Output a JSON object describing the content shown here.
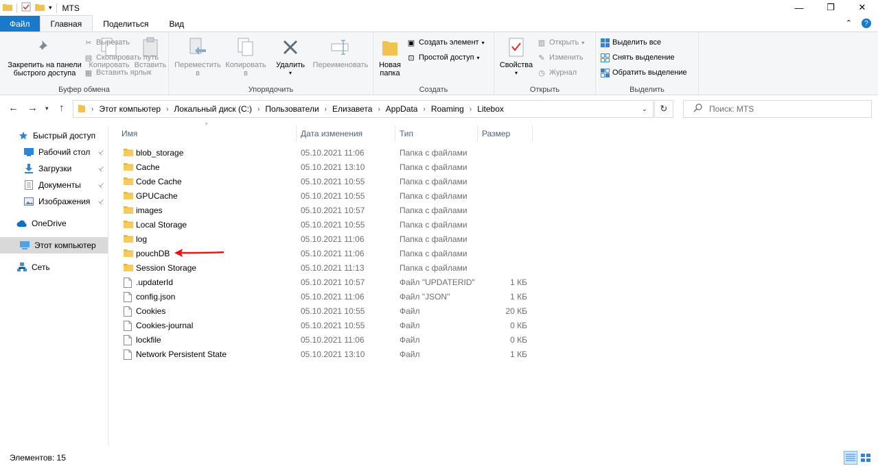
{
  "window": {
    "title": "MTS",
    "minimize": "—",
    "maximize": "❐",
    "close": "✕"
  },
  "tabs": {
    "file": "Файл",
    "home": "Главная",
    "share": "Поделиться",
    "view": "Вид"
  },
  "ribbon": {
    "clipboard": {
      "label": "Буфер обмена",
      "pin": "Закрепить на панели быстрого доступа",
      "pin_line1": "Закрепить на панели",
      "pin_line2": "быстрого доступа",
      "copy": "Копировать",
      "paste": "Вставить",
      "cut": "Вырезать",
      "copy_path": "Скопировать путь",
      "paste_shortcut": "Вставить ярлык"
    },
    "organize": {
      "label": "Упорядочить",
      "move_line1": "Переместить",
      "move_line2": "в",
      "copy_line1": "Копировать",
      "copy_line2": "в",
      "delete": "Удалить",
      "rename": "Переименовать"
    },
    "new": {
      "label": "Создать",
      "new_folder_line1": "Новая",
      "new_folder_line2": "папка",
      "new_item": "Создать элемент",
      "easy_access": "Простой доступ"
    },
    "open": {
      "label": "Открыть",
      "properties": "Свойства",
      "open": "Открыть",
      "edit": "Изменить",
      "history": "Журнал"
    },
    "select": {
      "label": "Выделить",
      "select_all": "Выделить все",
      "select_none": "Снять выделение",
      "invert": "Обратить выделение"
    }
  },
  "address": {
    "crumbs": [
      "Этот компьютер",
      "Локальный диск (C:)",
      "Пользователи",
      "Елизавета",
      "AppData",
      "Roaming",
      "Litebox"
    ],
    "search_placeholder": "Поиск: MTS"
  },
  "sidebar": {
    "items": [
      {
        "label": "Быстрый доступ",
        "icon": "star-icon",
        "pinned": false
      },
      {
        "label": "Рабочий стол",
        "icon": "desktop-icon",
        "pinned": true
      },
      {
        "label": "Загрузки",
        "icon": "download-icon",
        "pinned": true
      },
      {
        "label": "Документы",
        "icon": "documents-icon",
        "pinned": true
      },
      {
        "label": "Изображения",
        "icon": "pictures-icon",
        "pinned": true
      },
      {
        "label": "OneDrive",
        "icon": "cloud-icon",
        "pinned": false
      },
      {
        "label": "Этот компьютер",
        "icon": "computer-icon",
        "pinned": false,
        "selected": true
      },
      {
        "label": "Сеть",
        "icon": "network-icon",
        "pinned": false
      }
    ]
  },
  "columns": {
    "name": "Имя",
    "date": "Дата изменения",
    "type": "Тип",
    "size": "Размер"
  },
  "files": [
    {
      "name": "blob_storage",
      "date": "05.10.2021 11:06",
      "type": "Папка с файлами",
      "size": "",
      "kind": "folder"
    },
    {
      "name": "Cache",
      "date": "05.10.2021 13:10",
      "type": "Папка с файлами",
      "size": "",
      "kind": "folder"
    },
    {
      "name": "Code Cache",
      "date": "05.10.2021 10:55",
      "type": "Папка с файлами",
      "size": "",
      "kind": "folder"
    },
    {
      "name": "GPUCache",
      "date": "05.10.2021 10:55",
      "type": "Папка с файлами",
      "size": "",
      "kind": "folder"
    },
    {
      "name": "images",
      "date": "05.10.2021 10:57",
      "type": "Папка с файлами",
      "size": "",
      "kind": "folder"
    },
    {
      "name": "Local Storage",
      "date": "05.10.2021 10:55",
      "type": "Папка с файлами",
      "size": "",
      "kind": "folder"
    },
    {
      "name": "log",
      "date": "05.10.2021 11:06",
      "type": "Папка с файлами",
      "size": "",
      "kind": "folder"
    },
    {
      "name": "pouchDB",
      "date": "05.10.2021 11:06",
      "type": "Папка с файлами",
      "size": "",
      "kind": "folder"
    },
    {
      "name": "Session Storage",
      "date": "05.10.2021 11:13",
      "type": "Папка с файлами",
      "size": "",
      "kind": "folder"
    },
    {
      "name": ".updaterId",
      "date": "05.10.2021 10:57",
      "type": "Файл \"UPDATERID\"",
      "size": "1 КБ",
      "kind": "file"
    },
    {
      "name": "config.json",
      "date": "05.10.2021 11:06",
      "type": "Файл \"JSON\"",
      "size": "1 КБ",
      "kind": "file"
    },
    {
      "name": "Cookies",
      "date": "05.10.2021 10:55",
      "type": "Файл",
      "size": "20 КБ",
      "kind": "file"
    },
    {
      "name": "Cookies-journal",
      "date": "05.10.2021 10:55",
      "type": "Файл",
      "size": "0 КБ",
      "kind": "file"
    },
    {
      "name": "lockfile",
      "date": "05.10.2021 11:06",
      "type": "Файл",
      "size": "0 КБ",
      "kind": "file"
    },
    {
      "name": "Network Persistent State",
      "date": "05.10.2021 13:10",
      "type": "Файл",
      "size": "1 КБ",
      "kind": "file"
    }
  ],
  "status": {
    "count": "Элементов: 15"
  },
  "colors": {
    "accent": "#1979ca",
    "folder": "#f0c24f",
    "annotation_arrow": "#e8141a"
  }
}
